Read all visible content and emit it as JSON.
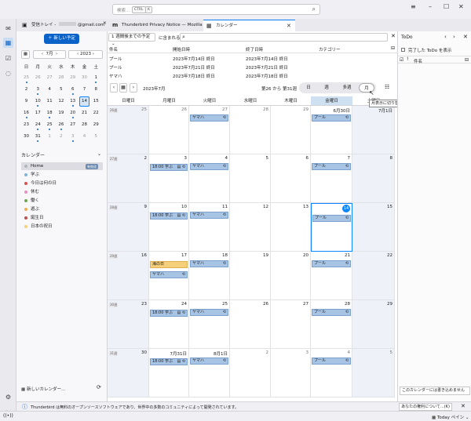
{
  "search": {
    "placeholder": "検索...",
    "kbd1": "CTRL",
    "kbd2": "K"
  },
  "window_controls": {
    "menu": "≡",
    "minimize": "–",
    "maximize": "☐",
    "close": "✕"
  },
  "tabs": [
    {
      "label": "受信トレイ - ",
      "account": "@gmail.com",
      "icon": "inbox-icon"
    },
    {
      "label": "Thunderbird Privacy Notice — Mozilla",
      "icon": "mozilla-icon"
    },
    {
      "label": "カレンダー",
      "icon": "calendar-icon"
    }
  ],
  "new_event_button": "新しい予定",
  "minical": {
    "month": "7月",
    "year": "2023",
    "weekdays": [
      "日",
      "月",
      "火",
      "水",
      "木",
      "金",
      "土"
    ],
    "days": [
      [
        "25",
        "26",
        "27",
        "28",
        "29",
        "30",
        "1"
      ],
      [
        "2",
        "3",
        "4",
        "5",
        "6",
        "7",
        "8"
      ],
      [
        "9",
        "10",
        "11",
        "12",
        "13",
        "14",
        "15"
      ],
      [
        "16",
        "17",
        "18",
        "19",
        "20",
        "21",
        "22"
      ],
      [
        "23",
        "24",
        "25",
        "26",
        "27",
        "28",
        "29"
      ],
      [
        "30",
        "31",
        "1",
        "2",
        "3",
        "4",
        "5"
      ]
    ]
  },
  "calendars": {
    "title": "カレンダー",
    "items": [
      {
        "name": "Home",
        "color": "#b5b5bd",
        "badge": "有効化"
      },
      {
        "name": "学ぶ",
        "color": "#7fb3d9"
      },
      {
        "name": "今日は何の日",
        "color": "#d9534f"
      },
      {
        "name": "休む",
        "color": "#e88fbf"
      },
      {
        "name": "働く",
        "color": "#6aa84f"
      },
      {
        "name": "遊ぶ",
        "color": "#f0ad4e"
      },
      {
        "name": "誕生日",
        "color": "#c0504d"
      },
      {
        "name": "日本の祝日",
        "color": "#f6d17a"
      }
    ],
    "new_calendar": "新しいカレンダー..."
  },
  "filter": {
    "select": "1 週間後までの予定",
    "contains": "に含まれる"
  },
  "list": {
    "headers": [
      "件名",
      "開始日時",
      "終了日時",
      "カテゴリー"
    ],
    "rows": [
      [
        "プール",
        "2023年7月14日 終日",
        "2023年7月14日 終日",
        ""
      ],
      [
        "プール",
        "2023年7月21日 終日",
        "2023年7月21日 終日",
        ""
      ],
      [
        "ヤマハ",
        "2023年7月18日 終日",
        "2023年7月18日 終日",
        ""
      ]
    ]
  },
  "view": {
    "title": "2023年7月",
    "weeks": "第26 から 第31週",
    "modes": [
      "日",
      "週",
      "多週",
      "月"
    ],
    "active": "月",
    "tooltip": "月表示に切り替えます"
  },
  "weekdays": [
    "日曜日",
    "月曜日",
    "火曜日",
    "水曜日",
    "木曜日",
    "金曜日",
    "土曜日"
  ],
  "weeks": [
    {
      "wk": "26週",
      "days": [
        "25",
        "26",
        "27",
        "28",
        "29",
        "6月30日",
        "7月1日"
      ]
    },
    {
      "wk": "27週",
      "days": [
        "2",
        "3",
        "4",
        "5",
        "6",
        "7",
        "8"
      ]
    },
    {
      "wk": "28週",
      "days": [
        "9",
        "10",
        "11",
        "12",
        "13",
        "14",
        "15"
      ]
    },
    {
      "wk": "29週",
      "days": [
        "16",
        "17",
        "18",
        "19",
        "20",
        "21",
        "22"
      ]
    },
    {
      "wk": "30週",
      "days": [
        "23",
        "24",
        "25",
        "26",
        "27",
        "28",
        "29"
      ]
    },
    {
      "wk": "31週",
      "days": [
        "30",
        "7月31日",
        "8月1日",
        "2",
        "3",
        "4",
        "5"
      ]
    }
  ],
  "events": {
    "pool": "プール",
    "yamaha": "ヤマハ",
    "study": "18:00 学ぶ",
    "umi": "海の日"
  },
  "todo": {
    "title": "ToDo",
    "show_completed": "完了した ToDo を表示",
    "col": "件名",
    "readonly": "このカレンダーには書き込めません"
  },
  "notice": {
    "text": "Thunderbird は無料のオープンソースソフトウェアであり、世界中の多数のコミュニティによって開発されています。",
    "button": "あなたの権利について...(K)"
  },
  "today_pane": "Today ペイン"
}
